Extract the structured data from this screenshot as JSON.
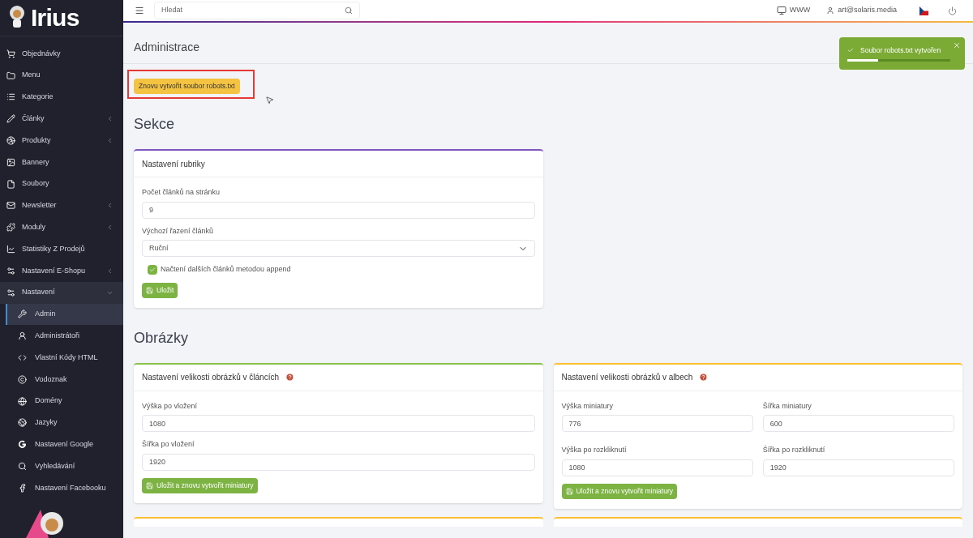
{
  "sidebar": {
    "logo": "Irius",
    "items": [
      {
        "label": "Objednávky",
        "has_submenu": false,
        "expanded": false,
        "selected": false
      },
      {
        "label": "Menu",
        "has_submenu": false,
        "expanded": false,
        "selected": false
      },
      {
        "label": "Kategorie",
        "has_submenu": false,
        "expanded": false,
        "selected": false
      },
      {
        "label": "Články",
        "has_submenu": true,
        "expanded": false,
        "selected": false
      },
      {
        "label": "Produkty",
        "has_submenu": true,
        "expanded": false,
        "selected": false
      },
      {
        "label": "Bannery",
        "has_submenu": false,
        "expanded": false,
        "selected": false
      },
      {
        "label": "Soubory",
        "has_submenu": false,
        "expanded": false,
        "selected": false
      },
      {
        "label": "Newsletter",
        "has_submenu": true,
        "expanded": false,
        "selected": false
      },
      {
        "label": "Moduly",
        "has_submenu": true,
        "expanded": false,
        "selected": false
      },
      {
        "label": "Statistiky Z Prodejů",
        "has_submenu": false,
        "expanded": false,
        "selected": false
      },
      {
        "label": "Nastavení E-Shopu",
        "has_submenu": true,
        "expanded": false,
        "selected": false
      },
      {
        "label": "Nastavení",
        "has_submenu": true,
        "expanded": true,
        "selected": false,
        "children": [
          {
            "label": "Admin",
            "selected": true
          },
          {
            "label": "Administrátoři",
            "selected": false
          },
          {
            "label": "Vlastní Kódy HTML",
            "selected": false
          },
          {
            "label": "Vodoznak",
            "selected": false
          },
          {
            "label": "Domény",
            "selected": false
          },
          {
            "label": "Jazyky",
            "selected": false
          },
          {
            "label": "Nastavení Google",
            "selected": false
          },
          {
            "label": "Vyhledávání",
            "selected": false
          },
          {
            "label": "Nastavení Facebooku",
            "selected": false
          }
        ]
      }
    ]
  },
  "topbar": {
    "search": {
      "placeholder": "Hledat"
    },
    "www": "WWW",
    "user": "art@solaris.media"
  },
  "toast": {
    "message": "Soubor robots.txt vytvořen",
    "level": 0.3
  },
  "page": {
    "title": "Administrace",
    "robots_button": "Znovu vytvořit soubor robots.txt"
  },
  "sections": [
    {
      "title": "Sekce",
      "cards": [
        {
          "title": "Nastavení rubriky",
          "color": "#7e57c2",
          "help": false,
          "kind": "single",
          "fields": [
            {
              "kind": "text",
              "label": "Počet článků na stránku",
              "value": "9"
            },
            {
              "kind": "select",
              "label": "Výchozí řazení článků",
              "value": "Ruční"
            },
            {
              "kind": "checkbox",
              "label": "Načtení dalších článků metodou append",
              "checked": true
            }
          ],
          "button": "Uložit"
        }
      ]
    },
    {
      "title": "Obrázky",
      "cards": [
        {
          "title": "Nastavení velikosti obrázků v článcích",
          "color": "#8bc34a",
          "help": true,
          "kind": "single",
          "fields": [
            {
              "kind": "text",
              "label": "Výška po vložení",
              "value": "1080"
            },
            {
              "kind": "text",
              "label": "Šířka po vložení",
              "value": "1920"
            }
          ],
          "button": "Uložit a znovu vytvořit miniatury"
        },
        {
          "title": "Nastavení velikosti obrázků v albech",
          "color": "#fbc02d",
          "help": true,
          "kind": "grid",
          "fields": [
            {
              "kind": "text",
              "label": "Výška miniatury",
              "value": "776"
            },
            {
              "kind": "text",
              "label": "Šířka miniatury",
              "value": "600"
            },
            {
              "kind": "text",
              "label": "Výška po rozkliknutí",
              "value": "1080"
            },
            {
              "kind": "text",
              "label": "Šířka po rozkliknutí",
              "value": "1920"
            }
          ],
          "button": "Uložit a znovu vytvořit miniatury"
        },
        {
          "kind": "stub",
          "color": "#fbc02d"
        },
        {
          "kind": "stub",
          "color": "#fbc02d"
        }
      ]
    }
  ]
}
